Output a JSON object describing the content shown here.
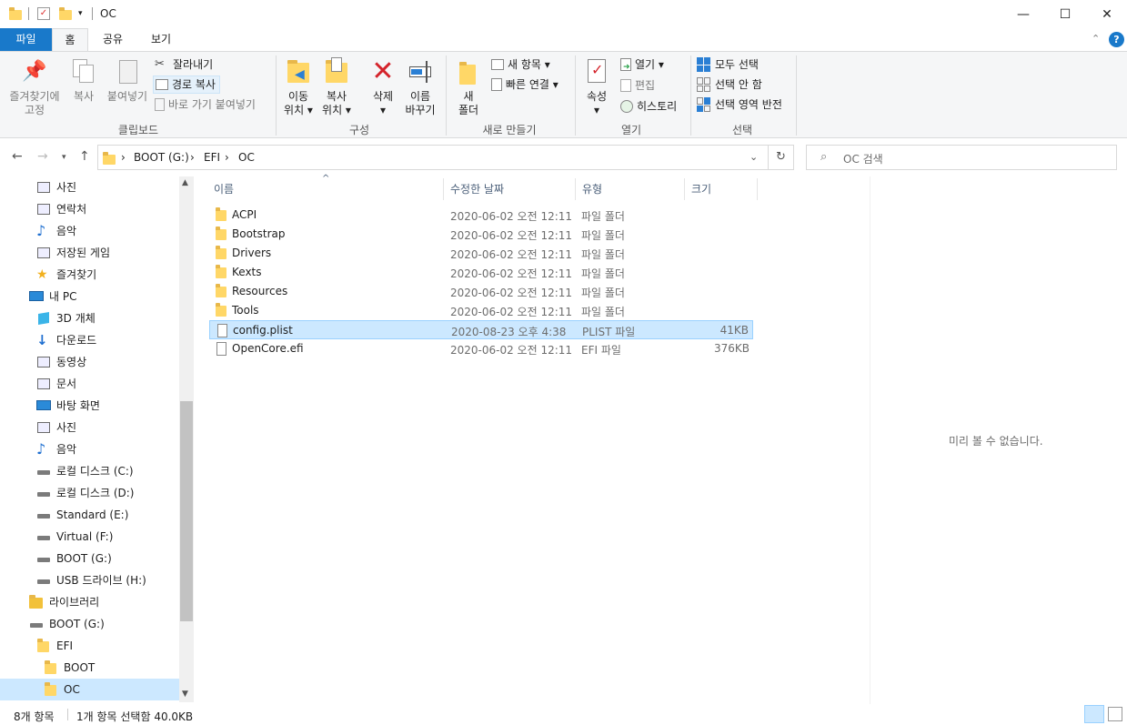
{
  "window": {
    "title": "OC",
    "minimize": "—",
    "maximize": "☐",
    "close": "✕"
  },
  "ribbon_tabs": [
    "파일",
    "홈",
    "공유",
    "보기"
  ],
  "ribbon": {
    "clipboard": {
      "pin_line1": "즐겨찾기에",
      "pin_line2": "고정",
      "copy": "복사",
      "paste": "붙여넣기",
      "cut": "잘라내기",
      "copy_path": "경로 복사",
      "paste_shortcut": "바로 가기 붙여넣기",
      "label": "클립보드"
    },
    "organize": {
      "move_line1": "이동",
      "move_line2": "위치 ▾",
      "copy_line1": "복사",
      "copy_line2": "위치 ▾",
      "delete_line1": "삭제",
      "delete_line2": "▾",
      "rename_line1": "이름",
      "rename_line2": "바꾸기",
      "label": "구성"
    },
    "new": {
      "folder_line1": "새",
      "folder_line2": "폴더",
      "new_item": "새 항목 ▾",
      "easy_access": "빠른 연결 ▾",
      "label": "새로 만들기"
    },
    "open": {
      "properties_line1": "속성",
      "properties_line2": "▾",
      "open": "열기 ▾",
      "edit": "편집",
      "history": "히스토리",
      "label": "열기"
    },
    "select": {
      "select_all": "모두 선택",
      "select_none": "선택 안 함",
      "invert": "선택 영역 반전",
      "label": "선택"
    }
  },
  "address": {
    "crumbs": [
      "BOOT (G:)",
      "EFI",
      "OC"
    ],
    "sep": "›",
    "search_placeholder": "OC 검색"
  },
  "nav_pane": [
    {
      "label": "사진",
      "icon": "pictures-icon"
    },
    {
      "label": "연락처",
      "icon": "contacts-icon"
    },
    {
      "label": "음악",
      "icon": "music-icon"
    },
    {
      "label": "저장된 게임",
      "icon": "saved-games-icon"
    },
    {
      "label": "즐겨찾기",
      "icon": "favorites-icon"
    },
    {
      "label": "내 PC",
      "icon": "this-pc-icon"
    },
    {
      "label": "3D 개체",
      "icon": "3d-objects-icon"
    },
    {
      "label": "다운로드",
      "icon": "downloads-icon"
    },
    {
      "label": "동영상",
      "icon": "videos-icon"
    },
    {
      "label": "문서",
      "icon": "documents-icon"
    },
    {
      "label": "바탕 화면",
      "icon": "desktop-icon"
    },
    {
      "label": "사진",
      "icon": "pictures-icon"
    },
    {
      "label": "음악",
      "icon": "music-icon"
    },
    {
      "label": "로컬 디스크 (C:)",
      "icon": "local-disk-icon"
    },
    {
      "label": "로컬 디스크 (D:)",
      "icon": "drive-icon"
    },
    {
      "label": "Standard (E:)",
      "icon": "drive-icon"
    },
    {
      "label": "Virtual (F:)",
      "icon": "drive-icon"
    },
    {
      "label": "BOOT (G:)",
      "icon": "drive-icon"
    },
    {
      "label": "USB 드라이브 (H:)",
      "icon": "drive-icon"
    },
    {
      "label": "라이브러리",
      "icon": "libraries-icon"
    },
    {
      "label": "BOOT (G:)",
      "icon": "drive-icon"
    },
    {
      "label": "EFI",
      "icon": "folder-icon"
    },
    {
      "label": "BOOT",
      "icon": "folder-icon"
    },
    {
      "label": "OC",
      "icon": "folder-icon"
    }
  ],
  "columns": {
    "name": "이름",
    "date": "수정한 날짜",
    "type": "유형",
    "size": "크기",
    "sort_arrow": "^"
  },
  "files": [
    {
      "name": "ACPI",
      "date": "2020-06-02 오전 12:11",
      "type": "파일 폴더",
      "size": "",
      "kind": "folder"
    },
    {
      "name": "Bootstrap",
      "date": "2020-06-02 오전 12:11",
      "type": "파일 폴더",
      "size": "",
      "kind": "folder"
    },
    {
      "name": "Drivers",
      "date": "2020-06-02 오전 12:11",
      "type": "파일 폴더",
      "size": "",
      "kind": "folder"
    },
    {
      "name": "Kexts",
      "date": "2020-06-02 오전 12:11",
      "type": "파일 폴더",
      "size": "",
      "kind": "folder"
    },
    {
      "name": "Resources",
      "date": "2020-06-02 오전 12:11",
      "type": "파일 폴더",
      "size": "",
      "kind": "folder"
    },
    {
      "name": "Tools",
      "date": "2020-06-02 오전 12:11",
      "type": "파일 폴더",
      "size": "",
      "kind": "folder"
    },
    {
      "name": "config.plist",
      "date": "2020-08-23 오후 4:38",
      "type": "PLIST 파일",
      "size": "41KB",
      "kind": "file"
    },
    {
      "name": "OpenCore.efi",
      "date": "2020-06-02 오전 12:11",
      "type": "EFI 파일",
      "size": "376KB",
      "kind": "file"
    }
  ],
  "preview_text": "미리 볼 수 없습니다.",
  "status": {
    "count": "8개 항목",
    "selection": "1개 항목 선택함 40.0KB"
  },
  "colors": {
    "accent": "#1979ca",
    "selection": "#cce8ff",
    "folder": "#ffd767"
  }
}
